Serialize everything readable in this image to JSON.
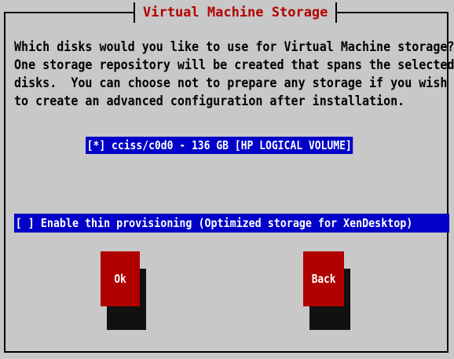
{
  "dialog": {
    "title": "Virtual Machine Storage",
    "message": "Which disks would you like to use for Virtual Machine storage?\nOne storage repository will be created that spans the selected\ndisks.  You can choose not to prepare any storage if you wish\nto create an advanced configuration after installation."
  },
  "disks": [
    {
      "label": "[*] cciss/c0d0 - 136 GB [HP LOGICAL VOLUME]",
      "selected": true
    }
  ],
  "thin_provisioning": {
    "label": "[ ] Enable thin provisioning (Optimized storage for XenDesktop)",
    "checked": false
  },
  "buttons": {
    "ok": "Ok",
    "back": "Back"
  },
  "colors": {
    "background": "#c8c8c8",
    "title": "#b30000",
    "highlight": "#0000c8",
    "button": "#b00000",
    "shadow": "#111111"
  }
}
